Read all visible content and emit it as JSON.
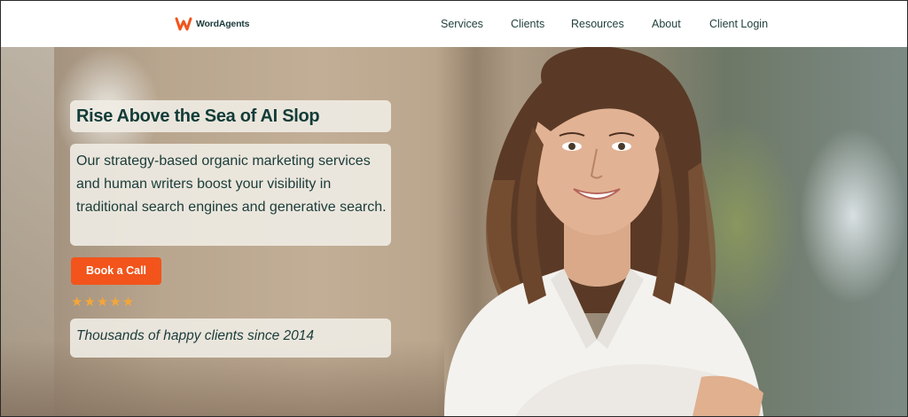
{
  "brand": {
    "name": "WordAgents",
    "accent": "#f2541b",
    "text_color": "#1e3e3c"
  },
  "nav": {
    "items": [
      {
        "label": "Services"
      },
      {
        "label": "Clients"
      },
      {
        "label": "Resources"
      },
      {
        "label": "About"
      },
      {
        "label": "Client Login"
      }
    ]
  },
  "hero": {
    "title": "Rise Above the Sea of AI Slop",
    "description": "Our strategy-based organic marketing services and human writers boost your visibility in traditional search engines and generative search.",
    "cta_label": "Book a Call",
    "rating": {
      "stars": 5,
      "icon": "star-icon",
      "color": "#f4a63a"
    },
    "testimonial": "Thousands of happy clients since 2014"
  }
}
